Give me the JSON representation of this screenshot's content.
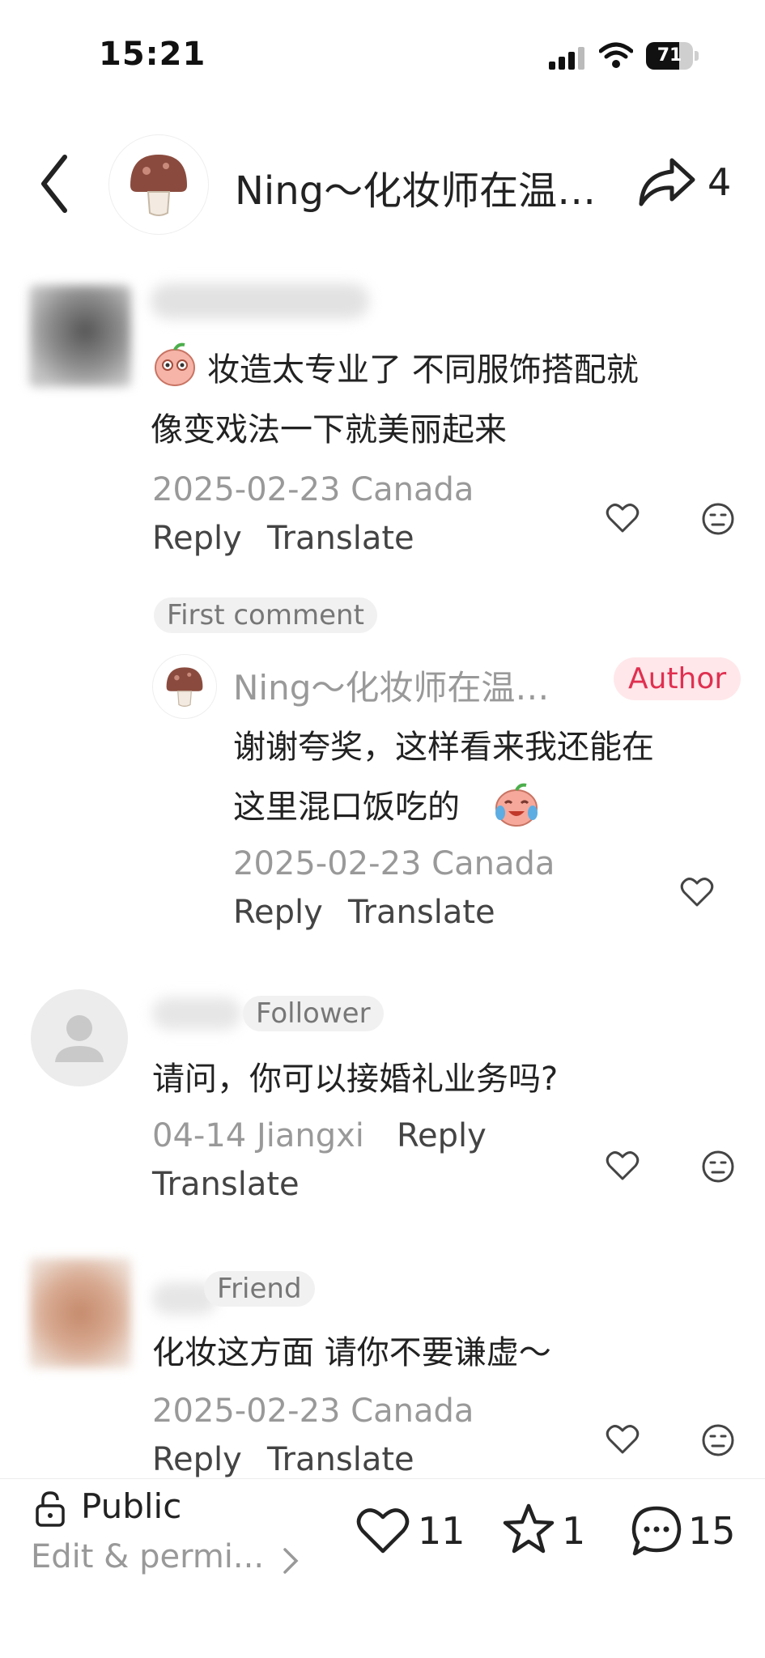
{
  "status": {
    "time": "15:21",
    "battery": "71",
    "battery_level": 0.71
  },
  "header": {
    "title": "Ning～化妆师在温…",
    "share_count": "4"
  },
  "comments": [
    {
      "text_line1": "妆造太专业了 不同服饰搭配就",
      "text_line2": "像变戏法一下就美丽起来",
      "meta": "2025-02-23 Canada",
      "reply": "Reply",
      "translate": "Translate"
    },
    {
      "tag": "Follower",
      "text": "请问，你可以接婚礼业务吗?",
      "meta": "04-14 Jiangxi",
      "reply": "Reply",
      "translate": "Translate"
    },
    {
      "tag": "Friend",
      "text": "化妆这方面 请你不要谦虚～",
      "meta": "2025-02-23 Canada",
      "reply": "Reply",
      "translate": "Translate"
    }
  ],
  "first_comment_label": "First comment",
  "author_reply": {
    "name": "Ning～化妆师在温…",
    "badge": "Author",
    "text_line1": "谢谢夸奖，这样看来我还能在",
    "text_line2": "这里混口饭吃的",
    "meta": "2025-02-23 Canada",
    "reply": "Reply",
    "translate": "Translate"
  },
  "bottom": {
    "public": "Public",
    "edit": "Edit & permi...",
    "likes": "11",
    "favorites": "1",
    "comments": "15"
  },
  "colors": {
    "author_badge_bg": "#ffe7ea",
    "author_badge_text": "#e03050",
    "muted": "#999999"
  }
}
